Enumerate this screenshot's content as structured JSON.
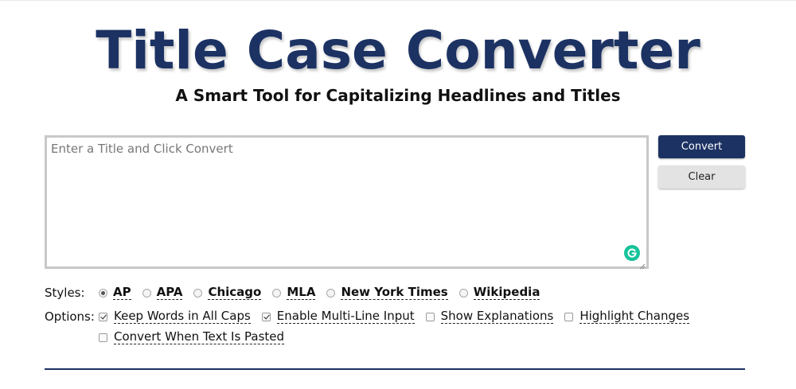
{
  "header": {
    "title": "Title Case Converter",
    "subtitle": "A Smart Tool for Capitalizing Headlines and Titles"
  },
  "editor": {
    "placeholder": "Enter a Title and Click Convert",
    "value": ""
  },
  "buttons": {
    "convert_label": "Convert",
    "clear_label": "Clear"
  },
  "styles": {
    "label": "Styles:",
    "options": [
      {
        "label": "AP",
        "selected": true
      },
      {
        "label": "APA",
        "selected": false
      },
      {
        "label": "Chicago",
        "selected": false
      },
      {
        "label": "MLA",
        "selected": false
      },
      {
        "label": "New York Times",
        "selected": false
      },
      {
        "label": "Wikipedia",
        "selected": false
      }
    ]
  },
  "options": {
    "label": "Options:",
    "items": [
      {
        "label": "Keep Words in All Caps",
        "checked": true
      },
      {
        "label": "Enable Multi-Line Input",
        "checked": true
      },
      {
        "label": "Show Explanations",
        "checked": false
      },
      {
        "label": "Highlight Changes",
        "checked": false
      },
      {
        "label": "Convert When Text Is Pasted",
        "checked": false
      }
    ]
  },
  "colors": {
    "brand_navy": "#1c3263",
    "grammarly_green": "#15c39a",
    "clear_button_bg": "#e3e3e3"
  },
  "icons": {
    "grammarly": "grammarly-icon",
    "resize": "resize-handle-icon"
  }
}
